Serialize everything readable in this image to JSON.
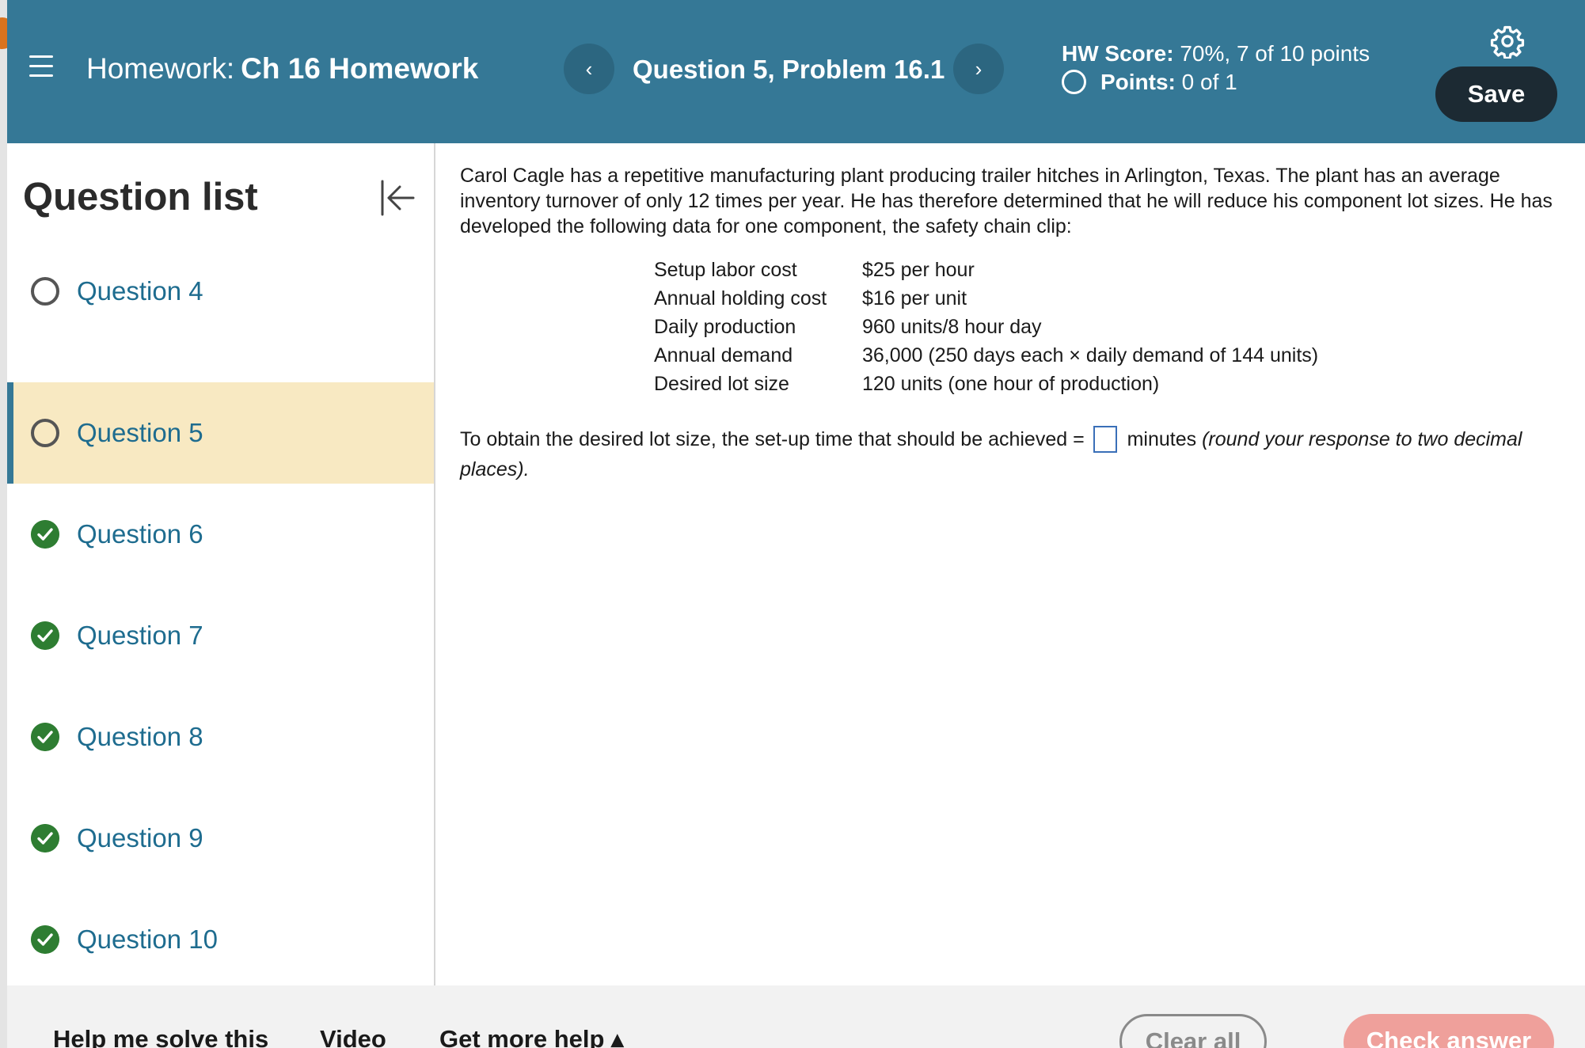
{
  "header": {
    "homework_label": "Homework:",
    "homework_name": "Ch 16 Homework",
    "question_title": "Question 5, Problem 16.1",
    "prev_label": "‹",
    "next_label": "›",
    "hw_score_label": "HW Score:",
    "hw_score_value": "70%, 7 of 10 points",
    "points_label": "Points:",
    "points_value": "0 of 1",
    "save_label": "Save"
  },
  "sidebar": {
    "title": "Question list",
    "items": [
      {
        "label": "Question 4",
        "status": "unanswered"
      },
      {
        "label": "Question 5",
        "status": "current"
      },
      {
        "label": "Question 6",
        "status": "correct"
      },
      {
        "label": "Question 7",
        "status": "correct"
      },
      {
        "label": "Question 8",
        "status": "correct"
      },
      {
        "label": "Question 9",
        "status": "correct"
      },
      {
        "label": "Question 10",
        "status": "correct"
      }
    ]
  },
  "problem": {
    "intro": "Carol Cagle has a repetitive manufacturing plant producing trailer hitches in Arlington, Texas. The plant has an average inventory turnover of only 12 times per year. He has therefore determined that he will reduce his component lot sizes. He has developed the following data for one component, the safety chain clip:",
    "data": [
      {
        "label": "Setup labor cost",
        "value": "$25 per hour"
      },
      {
        "label": "Annual holding cost",
        "value": "$16 per unit"
      },
      {
        "label": "Daily production",
        "value": "960 units/8 hour day"
      },
      {
        "label": "Annual demand",
        "value": "36,000 (250 days each × daily demand of 144 units)"
      },
      {
        "label": "Desired lot size",
        "value": "120 units (one hour of production)"
      }
    ],
    "question_prefix": "To obtain the desired lot size, the set-up time that should be achieved =",
    "question_unit": "minutes",
    "question_hint": "(round your response to two decimal places).",
    "answer_value": ""
  },
  "footer": {
    "help_label": "Help me solve this",
    "video_label": "Video",
    "more_help_label": "Get more help ▴",
    "clear_label": "Clear all",
    "check_label": "Check answer"
  },
  "colors": {
    "header_bg": "#357896",
    "active_item_bg": "#f8e9c2",
    "link_blue": "#1e6c8f",
    "correct_green": "#2e7d32",
    "save_bg": "#1c2a33",
    "check_bg": "#efa09b"
  },
  "icons": [
    "menu-icon",
    "chevron-left-icon",
    "chevron-right-icon",
    "gear-icon",
    "collapse-sidebar-icon",
    "empty-circle-icon",
    "check-circle-icon"
  ]
}
